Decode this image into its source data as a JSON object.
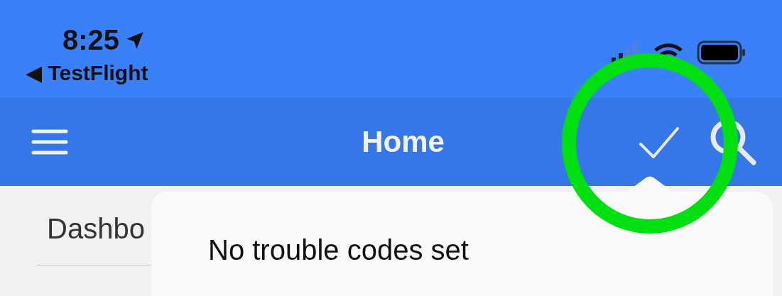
{
  "status_bar": {
    "time": "8:25",
    "back_label": "◀ TestFlight"
  },
  "nav_bar": {
    "title": "Home"
  },
  "content": {
    "section_label": "Dashbo"
  },
  "popover": {
    "message": "No trouble codes set"
  }
}
